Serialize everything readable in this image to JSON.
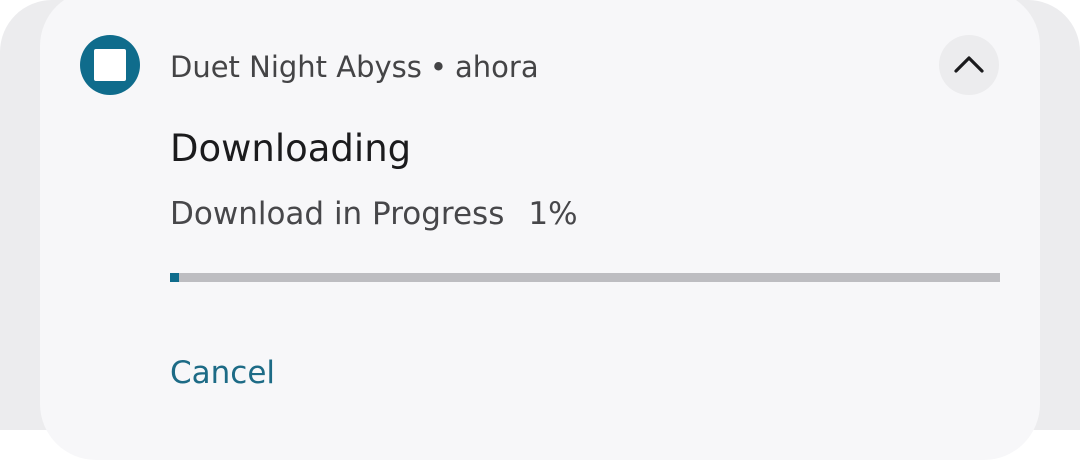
{
  "notification": {
    "app_name": "Duet Night Abyss",
    "separator": "•",
    "time": "ahora",
    "app_icon": "app-square-icon",
    "collapse_icon": "chevron-up-icon",
    "title": "Downloading",
    "text": "Download in Progress",
    "progress_text": "1%",
    "progress_fraction": 0.01,
    "action_cancel": "Cancel",
    "colors": {
      "accent": "#0f6c8c",
      "action_text": "#1d6b86",
      "card_background": "#f7f7f9",
      "track": "#bdbdc1"
    }
  }
}
